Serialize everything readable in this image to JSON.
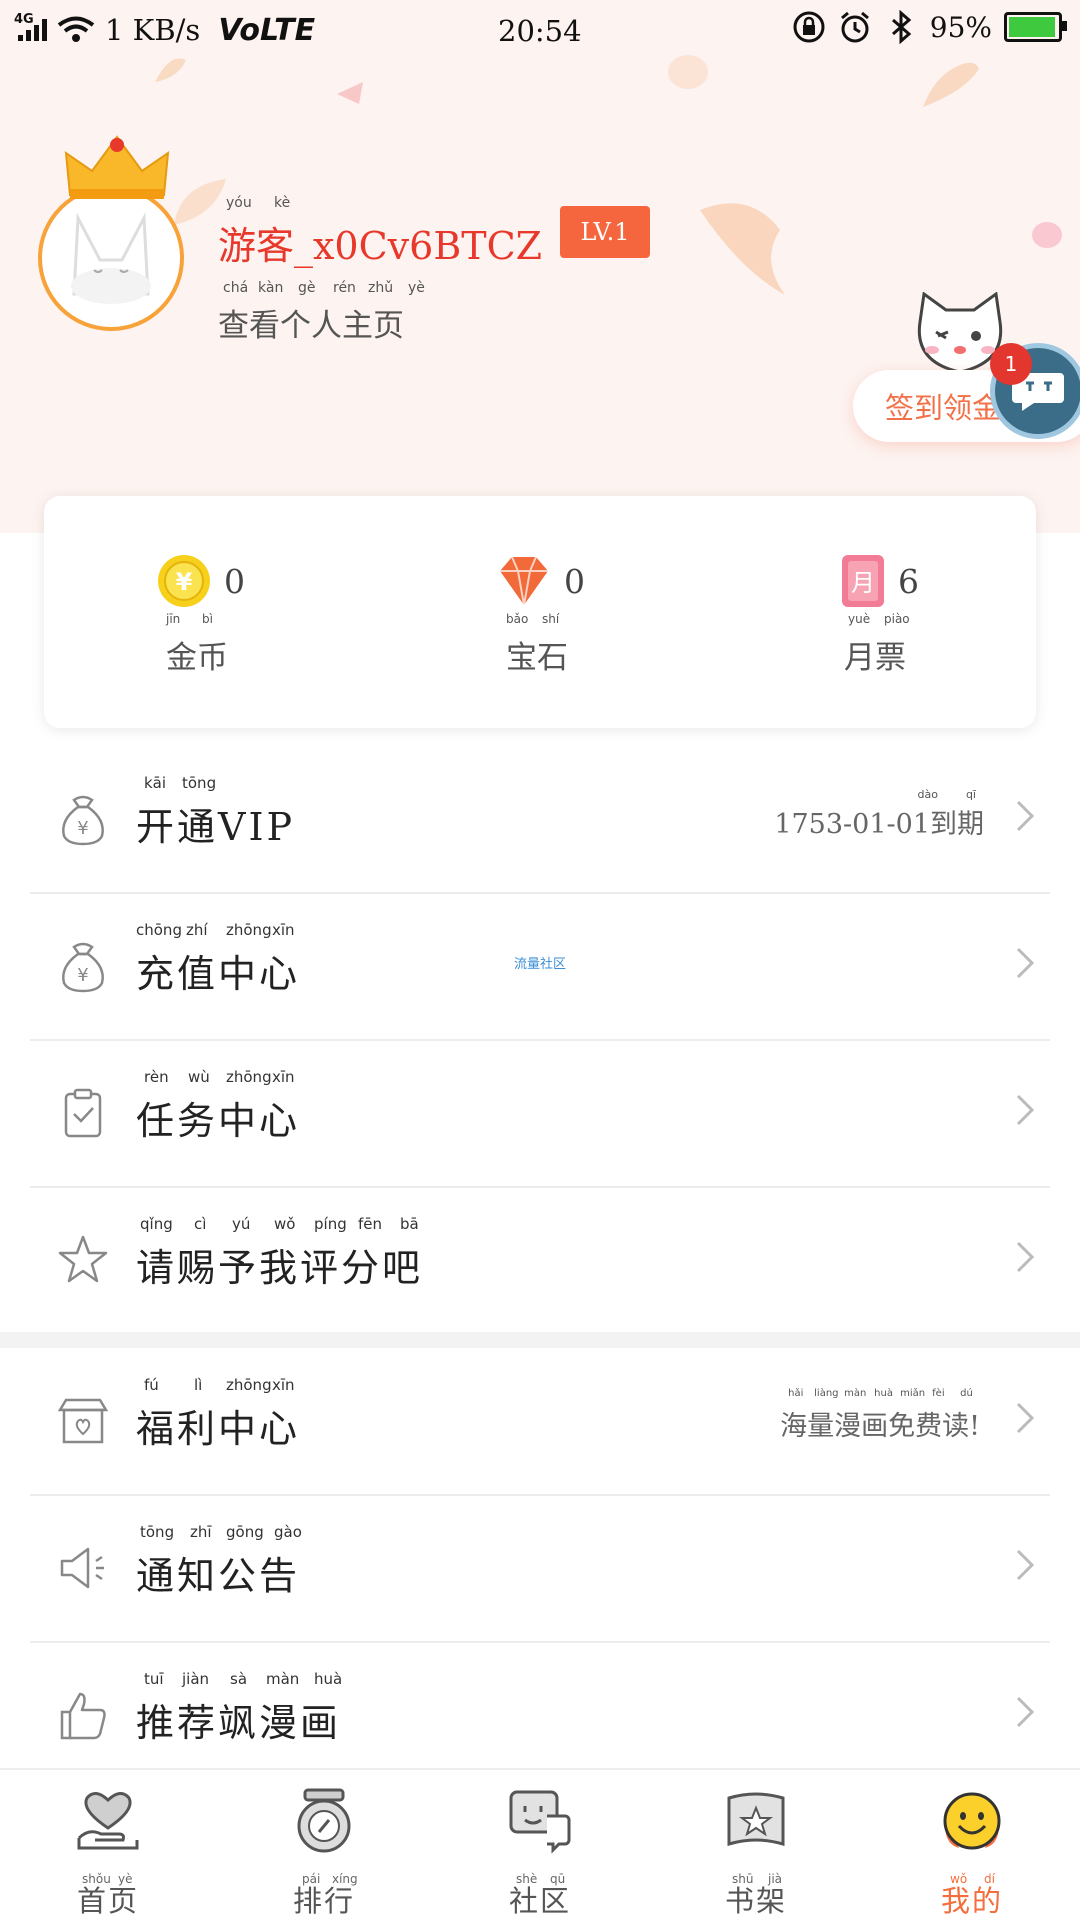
{
  "status_bar": {
    "network": "4G",
    "speed": "1 KB/s",
    "volte": "VoLTE",
    "time": "20:54",
    "battery": "95%"
  },
  "profile": {
    "username": "游客_x0Cv6BTCZ",
    "username_pinyin": [
      "yóu",
      "kè"
    ],
    "level": "LV.1",
    "profile_link": "查看个人主页",
    "profile_link_pinyin": [
      "chá",
      "kàn",
      "gè",
      "rén",
      "zhǔ",
      "yè"
    ],
    "checkin_label": "签到领金币",
    "float_badge_count": "1"
  },
  "wallet": [
    {
      "label": "金币",
      "pinyin": [
        "jīn",
        "bì"
      ],
      "value": "0",
      "icon": "gold-coin-icon"
    },
    {
      "label": "宝石",
      "pinyin": [
        "bǎo",
        "shí"
      ],
      "value": "0",
      "icon": "gem-icon"
    },
    {
      "label": "月票",
      "pinyin": [
        "yuè",
        "piào"
      ],
      "value": "6",
      "icon": "monthly-ticket-icon"
    }
  ],
  "menu": [
    {
      "label": "开通VIP",
      "pinyin": [
        "kāi",
        "tōng"
      ],
      "right": "1753-01-01到期",
      "right_pinyin": [
        "dào",
        "qī"
      ],
      "icon": "money-bag-icon"
    },
    {
      "label": "充值中心",
      "pinyin": [
        "chōng",
        "zhí",
        "zhōng",
        "xīn"
      ],
      "middle": "流量社区",
      "icon": "money-bag-icon"
    },
    {
      "label": "任务中心",
      "pinyin": [
        "rèn",
        "wù",
        "zhōng",
        "xīn"
      ],
      "icon": "clipboard-check-icon"
    },
    {
      "label": "请赐予我评分吧",
      "pinyin": [
        "qǐng",
        "cì",
        "yú",
        "wǒ",
        "píng",
        "fēn",
        "bā"
      ],
      "icon": "star-icon"
    },
    {
      "label": "福利中心",
      "pinyin": [
        "fú",
        "lì",
        "zhōng",
        "xīn"
      ],
      "right": "海量漫画免费读!",
      "right_pinyin": [
        "hǎi",
        "liàng",
        "màn",
        "huà",
        "miǎn",
        "fèi",
        "dú"
      ],
      "icon": "gift-shop-icon"
    },
    {
      "label": "通知公告",
      "pinyin": [
        "tōng",
        "zhī",
        "gōng",
        "gào"
      ],
      "icon": "megaphone-icon"
    },
    {
      "label": "推荐飒漫画",
      "pinyin": [
        "tuī",
        "jiàn",
        "sà",
        "màn",
        "huà"
      ],
      "icon": "thumbs-up-icon"
    }
  ],
  "bottom_nav": [
    {
      "label": "首页",
      "pinyin": [
        "shǒu",
        "yè"
      ],
      "icon": "home-heart-icon"
    },
    {
      "label": "排行",
      "pinyin": [
        "pái",
        "xíng"
      ],
      "icon": "ranking-stopwatch-icon"
    },
    {
      "label": "社区",
      "pinyin": [
        "shè",
        "qū"
      ],
      "icon": "community-chat-icon"
    },
    {
      "label": "书架",
      "pinyin": [
        "shū",
        "jià"
      ],
      "icon": "bookshelf-star-icon"
    },
    {
      "label": "我的",
      "pinyin": [
        "wǒ",
        "dí"
      ],
      "icon": "mine-smiley-icon",
      "active": true
    }
  ],
  "colors": {
    "accent": "#f36e3c",
    "username": "#e8382c",
    "level_badge": "#f5663e",
    "header_bg": "#fdf3f0"
  }
}
